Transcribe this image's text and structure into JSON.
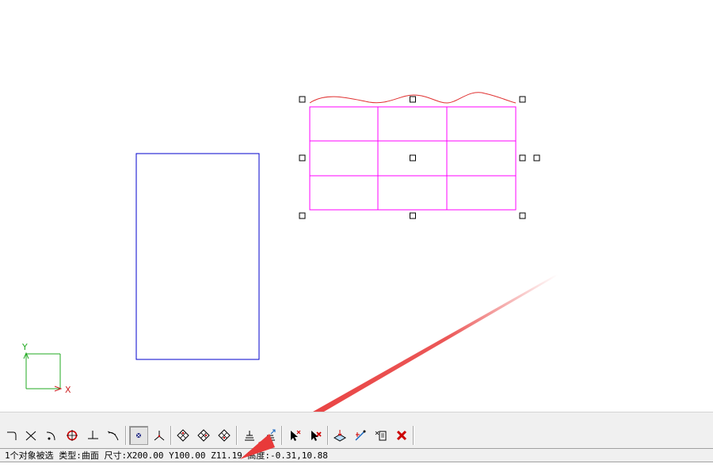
{
  "canvas": {
    "axis_y_label": "Y",
    "axis_x_label": "X",
    "colors": {
      "rectangle": "#0000cc",
      "grid_surface": "#ff00ff",
      "curve": "#e03030",
      "axis_y": "#22aa22",
      "axis_x": "#cc2222",
      "handle": "#000000",
      "annotation_arrow": "#e83a3a"
    }
  },
  "toolbar": {
    "buttons": [
      {
        "name": "fillet-button",
        "icon": "fillet-icon"
      },
      {
        "name": "trim-button",
        "icon": "trim-icon"
      },
      {
        "name": "arc-button",
        "icon": "arc-icon"
      },
      {
        "name": "circle-button",
        "icon": "circle-icon"
      },
      {
        "name": "perpendicular-button",
        "icon": "perpendicular-icon"
      },
      {
        "name": "tangent-button",
        "icon": "tangent-icon"
      },
      {
        "name": "snap-point-button",
        "icon": "snap-point-icon",
        "pressed": true
      },
      {
        "name": "axis-button",
        "icon": "axis-icon"
      },
      {
        "name": "surface-view-1-button",
        "icon": "surface-view-icon"
      },
      {
        "name": "surface-view-2-button",
        "icon": "surface-view-icon"
      },
      {
        "name": "surface-view-3-button",
        "icon": "surface-view-icon"
      },
      {
        "name": "layer-button",
        "icon": "layer-icon"
      },
      {
        "name": "layer-arrow-button",
        "icon": "layer-arrow-icon"
      },
      {
        "name": "select-remove-button",
        "icon": "select-remove-icon"
      },
      {
        "name": "select-delete-button",
        "icon": "select-delete-icon"
      },
      {
        "name": "surface-edit-button",
        "icon": "surface-edit-icon"
      },
      {
        "name": "path-edit-button",
        "icon": "path-edit-icon"
      },
      {
        "name": "copy-button",
        "icon": "copy-icon"
      },
      {
        "name": "delete-button",
        "icon": "delete-icon"
      }
    ]
  },
  "statusbar": {
    "text": "1个对象被选 类型:曲面 尺寸:X200.00 Y100.00 Z11.19 高度:-0.31,10.88"
  }
}
